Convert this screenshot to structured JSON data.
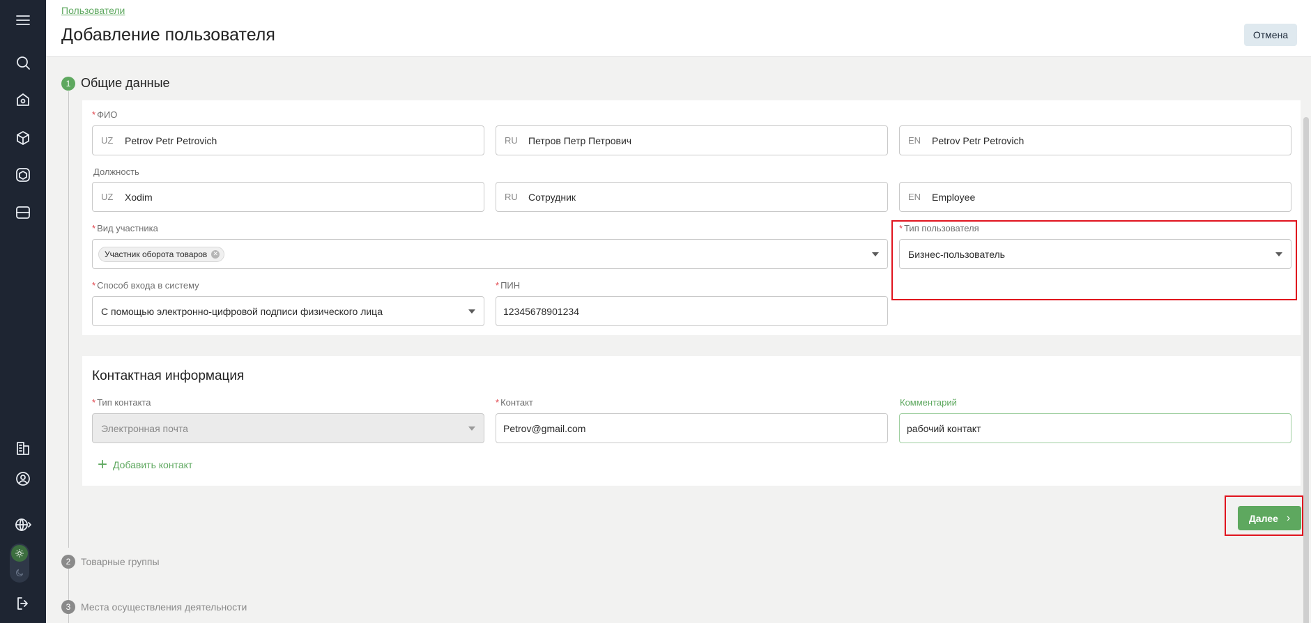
{
  "header": {
    "breadcrumb": "Пользователи",
    "title": "Добавление пользователя",
    "cancel_label": "Отмена"
  },
  "sidebar": {
    "icons": [
      "menu-icon",
      "search-icon",
      "home-icon",
      "box-icon",
      "package-icon",
      "server-icon",
      "building-icon",
      "profile-icon",
      "globe-icon",
      "sun-icon",
      "moon-icon",
      "logout-icon"
    ]
  },
  "steps": [
    {
      "number": "1",
      "title": "Общие данные",
      "active": true
    },
    {
      "number": "2",
      "title": "Товарные группы",
      "active": false
    },
    {
      "number": "3",
      "title": "Места осуществления деятельности",
      "active": false
    }
  ],
  "general": {
    "fio_label": "ФИО",
    "fio": [
      {
        "lang": "UZ",
        "value": "Petrov Petr Petrovich"
      },
      {
        "lang": "RU",
        "value": "Петров Петр Петрович"
      },
      {
        "lang": "EN",
        "value": "Petrov Petr Petrovich"
      }
    ],
    "position_label": "Должность",
    "position": [
      {
        "lang": "UZ",
        "value": "Xodim"
      },
      {
        "lang": "RU",
        "value": "Сотрудник"
      },
      {
        "lang": "EN",
        "value": "Employee"
      }
    ],
    "participant_label": "Вид участника",
    "participant_chip": "Участник оборота товаров",
    "user_type_label": "Тип пользователя",
    "user_type_value": "Бизнес-пользователь",
    "login_method_label": "Способ входа в систему",
    "login_method_value": "С помощью электронно-цифровой подписи физического лица",
    "pin_label": "ПИН",
    "pin_value": "12345678901234"
  },
  "contacts": {
    "title": "Контактная информация",
    "contact_type_label": "Тип контакта",
    "contact_type_value": "Электронная почта",
    "contact_label": "Контакт",
    "contact_value": "Petrov@gmail.com",
    "comment_label": "Комментарий",
    "comment_value": "рабочий контакт",
    "add_contact": "Добавить контакт"
  },
  "footer": {
    "next_label": "Далее"
  },
  "colors": {
    "accent": "#5ea85f",
    "sidebar": "#1e2532",
    "required": "#e0434b",
    "highlight": "#e0141e"
  }
}
